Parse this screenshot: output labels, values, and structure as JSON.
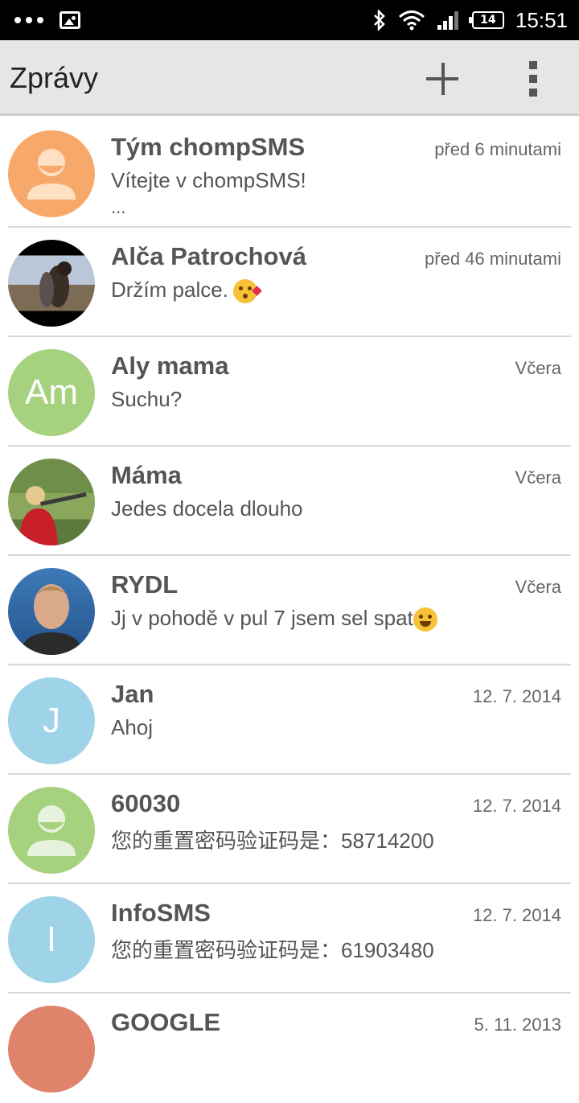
{
  "status_bar": {
    "time": "15:51",
    "battery": "14",
    "icons": [
      "more-dots-icon",
      "gallery-icon",
      "bluetooth-icon",
      "wifi-icon",
      "signal-icon",
      "battery-icon"
    ]
  },
  "app_bar": {
    "title": "Zprávy",
    "actions": [
      "add-icon",
      "overflow-menu-icon"
    ]
  },
  "colors": {
    "orange": "#f7a96b",
    "green": "#a6d17e",
    "blue": "#9ed3e8",
    "salmon": "#e0836b"
  },
  "conversations": [
    {
      "name": "Tým chompSMS",
      "time": "před 6 minutami",
      "snippet": "Vítejte v chompSMS!",
      "snippet2": "...",
      "avatar": "person-icon",
      "avatar_color": "#f7a96b"
    },
    {
      "name": "Alča Patrochová",
      "time": "před 46 minutami",
      "snippet": "Držím palce.",
      "emoji": "kiss-emoji-icon",
      "avatar": "photo"
    },
    {
      "name": "Aly mama",
      "time": "Včera",
      "snippet": "Suchu?",
      "avatar_initials": "Am",
      "avatar_color": "#a6d17e"
    },
    {
      "name": "Máma",
      "time": "Včera",
      "snippet": "Jedes docela dlouho",
      "avatar": "photo"
    },
    {
      "name": "RYDL",
      "time": "Včera",
      "snippet": "Jj v pohodě v pul 7 jsem sel spat",
      "emoji": "smile-emoji-icon",
      "avatar": "photo"
    },
    {
      "name": "Jan",
      "time": "12. 7. 2014",
      "snippet": "Ahoj",
      "avatar_initials": "J",
      "avatar_color": "#9ed3e8"
    },
    {
      "name": "60030",
      "time": "12. 7. 2014",
      "snippet": "您的重置密码验证码是：58714200",
      "avatar": "person-icon",
      "avatar_color": "#a6d17e"
    },
    {
      "name": "InfoSMS",
      "time": "12. 7. 2014",
      "snippet": "您的重置密码验证码是：61903480",
      "avatar_initials": "I",
      "avatar_color": "#9ed3e8"
    },
    {
      "name": "GOOGLE",
      "time": "5. 11. 2013",
      "snippet": "",
      "avatar_color": "#e0836b"
    }
  ]
}
